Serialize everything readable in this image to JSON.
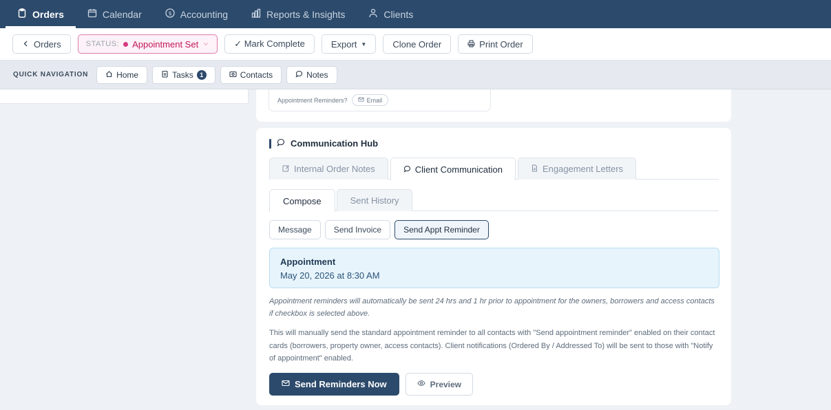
{
  "topnav": {
    "items": [
      {
        "label": "Orders",
        "icon": "clipboard-icon",
        "active": true
      },
      {
        "label": "Calendar",
        "icon": "calendar-icon",
        "active": false
      },
      {
        "label": "Accounting",
        "icon": "dollar-circle-icon",
        "active": false
      },
      {
        "label": "Reports & Insights",
        "icon": "bar-chart-icon",
        "active": false
      },
      {
        "label": "Clients",
        "icon": "users-icon",
        "active": false
      }
    ]
  },
  "toolbar": {
    "back_label": "Orders",
    "status_key": "STATUS:",
    "status_value": "Appointment Set",
    "mark_complete": "✓ Mark Complete",
    "export": "Export",
    "clone": "Clone Order",
    "print": "Print Order"
  },
  "quicknav": {
    "label": "QUICK NAVIGATION",
    "home": "Home",
    "tasks": "Tasks",
    "tasks_count": "1",
    "contacts": "Contacts",
    "notes": "Notes"
  },
  "upper": {
    "reminders_label": "Appointment Reminders?",
    "email_chip": "Email"
  },
  "comm": {
    "title": "Communication Hub",
    "tabs": {
      "internal": "Internal Order Notes",
      "client": "Client Communication",
      "engagement": "Engagement Letters"
    },
    "subtabs": {
      "compose": "Compose",
      "history": "Sent History"
    },
    "msg_types": {
      "message": "Message",
      "invoice": "Send Invoice",
      "reminder": "Send Appt Reminder"
    },
    "appointment": {
      "title": "Appointment",
      "date": "May 20, 2026 at 8:30 AM"
    },
    "auto_note": "Appointment reminders will automatically be sent 24 hrs and 1 hr prior to appointment for the owners, borrowers and access contacts if checkbox is selected above.",
    "manual_note": "This will manually send the standard appointment reminder to all contacts with \"Send appointment reminder\" enabled on their contact cards (borrowers, property owner, access contacts). Client notifications (Ordered By / Addressed To) will be sent to those with \"Notify of appointment\" enabled.",
    "send_button": "Send Reminders Now",
    "preview_button": "Preview"
  },
  "colors": {
    "nav_bg": "#2c4a6b",
    "status_pink": "#c2185b",
    "appt_bg": "#e7f4fc"
  }
}
